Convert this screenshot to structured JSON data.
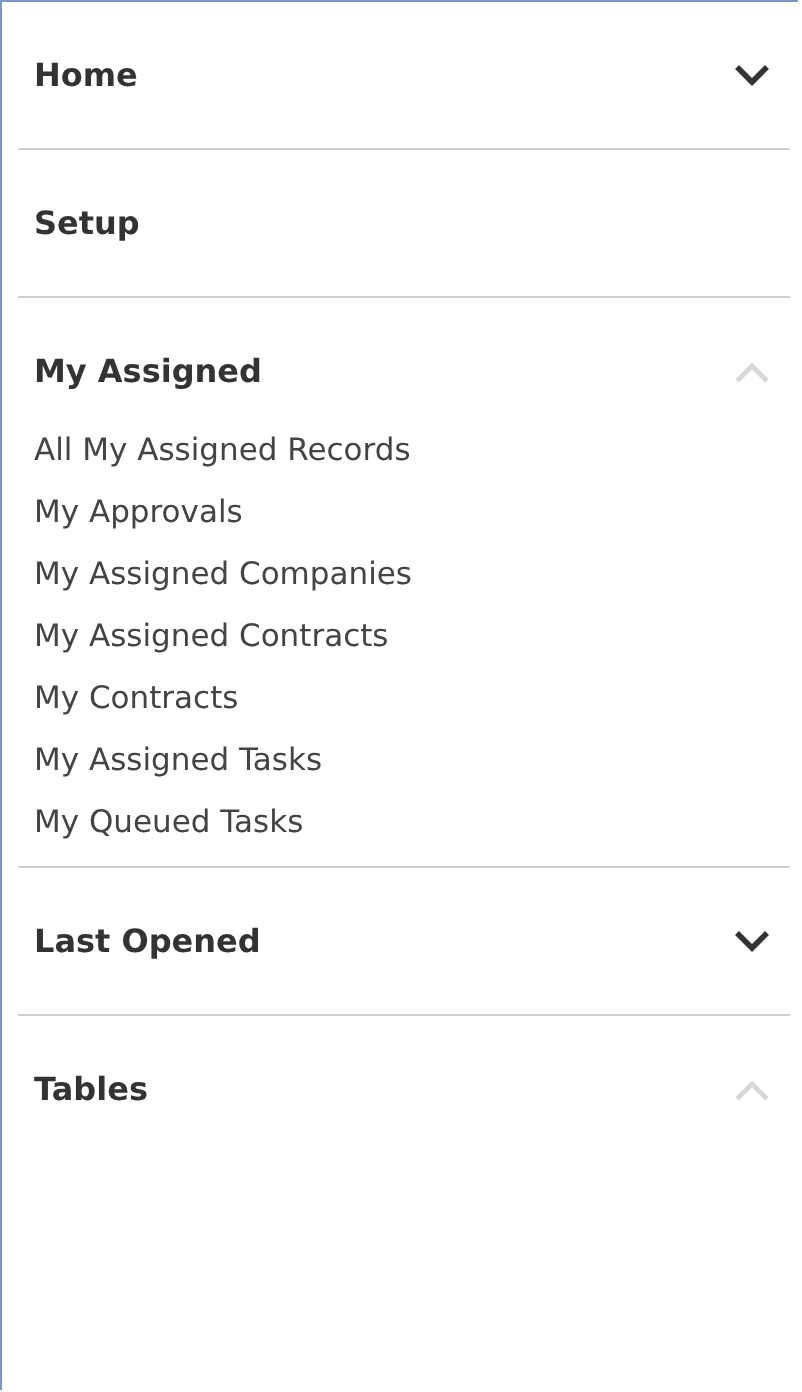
{
  "sections": [
    {
      "title": "Home",
      "kind": "group",
      "expanded": false
    },
    {
      "title": "Setup",
      "kind": "link"
    },
    {
      "title": "My Assigned",
      "kind": "group",
      "expanded": true,
      "items": [
        "All My Assigned Records",
        "My Approvals",
        "My Assigned Companies",
        "My Assigned Contracts",
        "My Contracts",
        "My Assigned Tasks",
        "My Queued Tasks"
      ]
    },
    {
      "title": "Last Opened",
      "kind": "group",
      "expanded": false
    },
    {
      "title": "Tables",
      "kind": "group",
      "expanded": true
    }
  ]
}
